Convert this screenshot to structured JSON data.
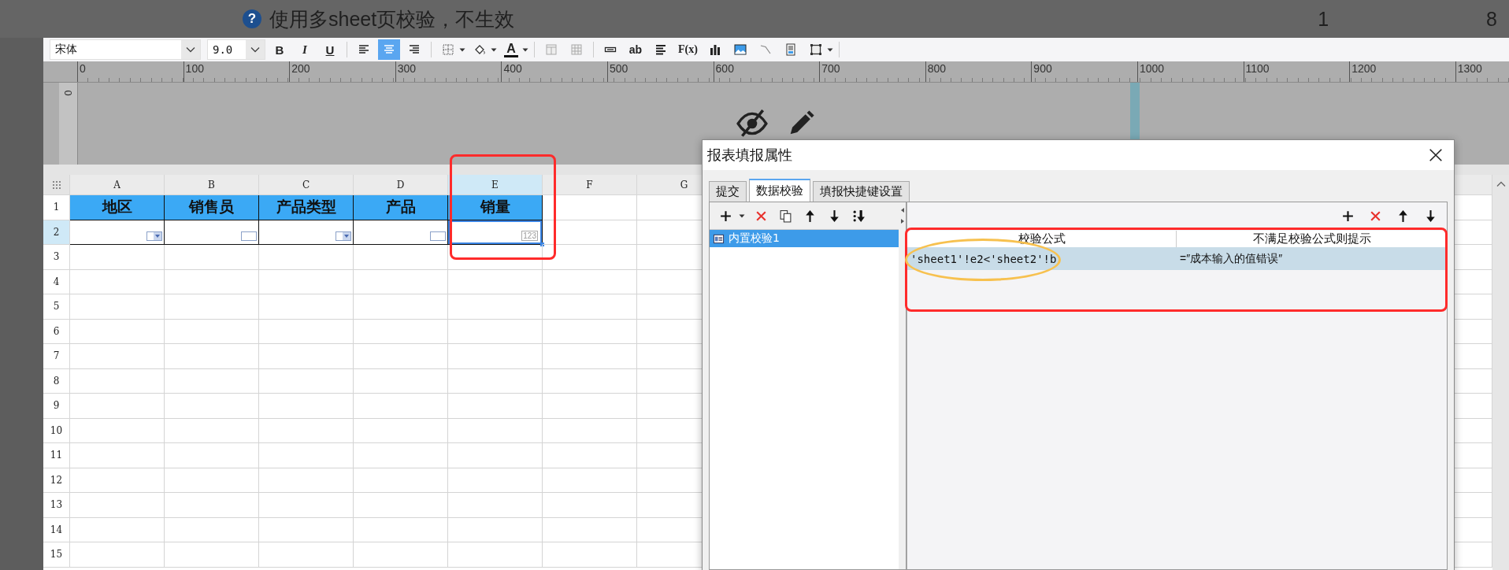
{
  "background_page": {
    "question_mark": "?",
    "question": "使用多sheet页校验，不生效",
    "values": [
      "1",
      "8"
    ]
  },
  "toolbar": {
    "font_family": "宋体",
    "font_size": "9.0",
    "items": [
      {
        "kind": "bold",
        "label": "B",
        "selected": false
      },
      {
        "kind": "italic",
        "label": "I",
        "selected": false
      },
      {
        "kind": "underline",
        "label": "U",
        "selected": false
      },
      {
        "kind": "separator"
      },
      {
        "kind": "icon",
        "selected": false,
        "dropdown": false
      },
      {
        "kind": "icon",
        "selected": true,
        "dropdown": false
      },
      {
        "kind": "icon",
        "selected": false,
        "dropdown": false
      },
      {
        "kind": "separator"
      },
      {
        "kind": "icon",
        "selected": false,
        "dropdown": true
      },
      {
        "kind": "icon",
        "selected": false,
        "dropdown": true
      },
      {
        "kind": "color",
        "label": "A",
        "selected": false,
        "dropdown": true
      },
      {
        "kind": "separator"
      },
      {
        "kind": "icon",
        "selected": false,
        "dropdown": false
      },
      {
        "kind": "icon",
        "selected": false,
        "dropdown": false
      },
      {
        "kind": "separator"
      },
      {
        "kind": "icon",
        "selected": false,
        "dropdown": false
      },
      {
        "kind": "label",
        "label": "ab",
        "selected": false
      },
      {
        "kind": "icon",
        "selected": false,
        "dropdown": false
      },
      {
        "kind": "formula",
        "label": "F(x)",
        "selected": false
      },
      {
        "kind": "icon",
        "selected": false,
        "dropdown": false
      },
      {
        "kind": "icon",
        "selected": false,
        "dropdown": false
      },
      {
        "kind": "icon",
        "selected": false,
        "dropdown": false
      },
      {
        "kind": "icon",
        "selected": false,
        "dropdown": false
      },
      {
        "kind": "icon",
        "selected": false,
        "dropdown": true
      },
      {
        "kind": "separator"
      }
    ]
  },
  "ruler": {
    "horizontal": [
      "0",
      "100",
      "200",
      "300",
      "400",
      "500",
      "600",
      "700",
      "800",
      "900",
      "1000",
      "1100",
      "1200",
      "1300"
    ],
    "vertical": [
      "0"
    ]
  },
  "sheet": {
    "columns": [
      {
        "label": "A",
        "selected": false
      },
      {
        "label": "B",
        "selected": false
      },
      {
        "label": "C",
        "selected": false
      },
      {
        "label": "D",
        "selected": false
      },
      {
        "label": "E",
        "selected": true
      },
      {
        "label": "F",
        "selected": false
      },
      {
        "label": "G",
        "selected": false
      }
    ],
    "rows": [
      {
        "label": "1",
        "kind": "header",
        "selected": false,
        "cells": [
          "地区",
          "销售员",
          "产品类型",
          "产品",
          "销量"
        ]
      },
      {
        "label": "2",
        "kind": "input",
        "selected": true,
        "cells": [
          {
            "kind": "dropdown",
            "selected": false
          },
          {
            "kind": "text",
            "selected": false
          },
          {
            "kind": "dropdown",
            "selected": false
          },
          {
            "kind": "text",
            "selected": false
          },
          {
            "kind": "number",
            "label": "123",
            "selected": true
          }
        ]
      },
      {
        "label": "3",
        "selected": false
      },
      {
        "label": "4",
        "selected": false
      },
      {
        "label": "5",
        "selected": false
      },
      {
        "label": "6",
        "selected": false
      },
      {
        "label": "7",
        "selected": false
      },
      {
        "label": "8",
        "selected": false
      },
      {
        "label": "9",
        "selected": false
      },
      {
        "label": "10",
        "selected": false
      },
      {
        "label": "11",
        "selected": false
      },
      {
        "label": "12",
        "selected": false
      },
      {
        "label": "13",
        "selected": false
      },
      {
        "label": "14",
        "selected": false
      },
      {
        "label": "15",
        "selected": false
      }
    ]
  },
  "dialog": {
    "title": "报表填报属性",
    "tabs": [
      {
        "label": "提交",
        "selected": false
      },
      {
        "label": "数据校验",
        "selected": true
      },
      {
        "label": "填报快捷键设置",
        "selected": false
      }
    ],
    "left_toolbar": [
      {
        "dropdown": true
      },
      {
        "dropdown": false
      },
      {
        "dropdown": false
      },
      {
        "dropdown": false
      },
      {
        "dropdown": false
      },
      {
        "dropdown": false
      }
    ],
    "rules": [
      {
        "label": "内置校验1",
        "selected": true
      }
    ],
    "rules_table": {
      "columns": [
        "校验公式",
        "不满足校验公式则提示"
      ],
      "rows": [
        {
          "cells": [
            "'sheet1'!e2<'sheet2'!b",
            "=″成本输入的值错误″"
          ],
          "selected": true
        }
      ]
    }
  },
  "annotations": [
    {
      "kind": "rectangle",
      "color": "#ff2b2b"
    },
    {
      "kind": "rectangle",
      "color": "#ff2b2b"
    },
    {
      "kind": "ellipse",
      "color": "#f7c14f"
    }
  ]
}
